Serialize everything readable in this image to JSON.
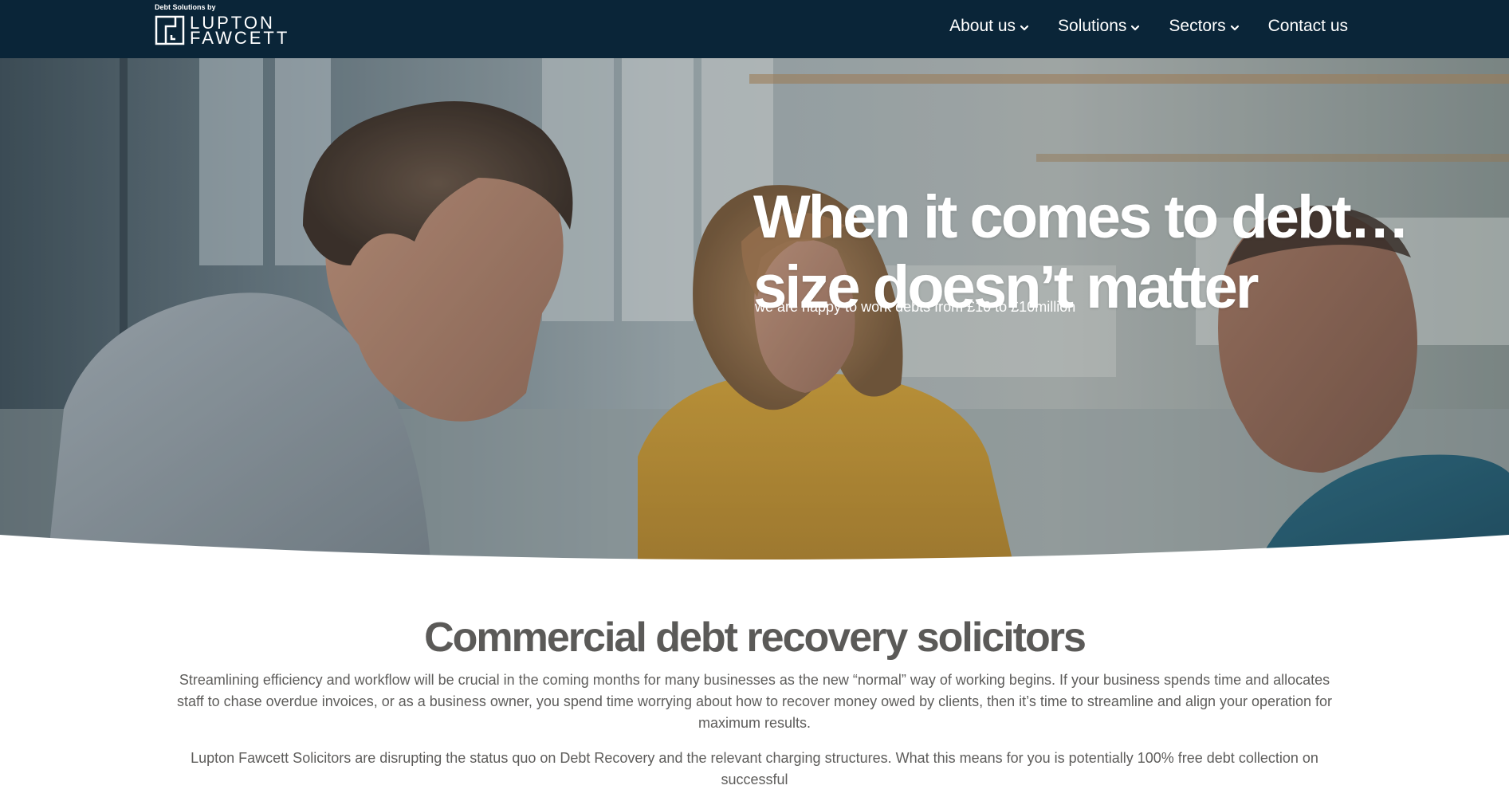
{
  "header": {
    "brand_tagline": "Debt Solutions by",
    "brand_line1": "LUPTON",
    "brand_line2": "FAWCETT",
    "background_color": "#0a2538"
  },
  "nav": {
    "items": [
      {
        "label": "About us",
        "has_dropdown": true,
        "icon": "chevron-down-icon"
      },
      {
        "label": "Solutions",
        "has_dropdown": true,
        "icon": "chevron-down-icon"
      },
      {
        "label": "Sectors",
        "has_dropdown": true,
        "icon": "chevron-down-icon"
      },
      {
        "label": "Contact us",
        "has_dropdown": false
      }
    ]
  },
  "hero": {
    "title_line1": "When it comes to debt…",
    "title_line2": "size doesn’t matter",
    "subtitle": "we are happy to work debts from £10 to £10million"
  },
  "main": {
    "heading": "Commercial debt recovery solicitors",
    "paragraph1": "Streamlining efficiency and workflow will be crucial in the coming months for many businesses as the new “normal” way of working begins. If your business spends time and allocates staff to chase overdue invoices, or as a business owner, you spend time worrying about how to recover money owed by clients, then it’s time to streamline and align your operation for maximum results.",
    "paragraph2": "Lupton Fawcett Solicitors are disrupting the status quo on Debt Recovery and the relevant charging structures. What this means for you is potentially 100% free debt collection on successful"
  }
}
